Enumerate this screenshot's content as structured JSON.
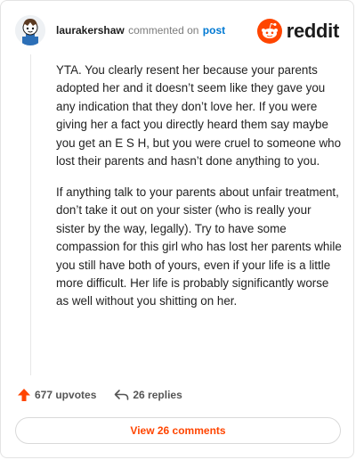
{
  "header": {
    "username": "laurakershaw",
    "action_text": "commented on",
    "target_text": "post",
    "brand_name": "reddit"
  },
  "comment": {
    "paragraphs": [
      "YTA. You clearly resent her because your parents adopted her and it doesn’t seem like they gave you any indication that they don’t love her. If you were giving her a fact you directly heard them say maybe you get an E S H, but you were cruel to someone who lost their parents and hasn’t done anything to you.",
      "If anything talk to your parents about unfair treatment, don’t take it out on your sister (who is really your sister by the way, legally). Try to have some compassion for this girl who has lost her parents while you still have both of yours, even if your life is a little more difficult. Her life is probably significantly worse as well without you shitting on her."
    ]
  },
  "actions": {
    "upvotes_label": "677 upvotes",
    "replies_label": "26 replies"
  },
  "footer": {
    "view_comments_label": "View 26 comments"
  },
  "colors": {
    "accent": "#ff4500",
    "link": "#0079d3"
  }
}
